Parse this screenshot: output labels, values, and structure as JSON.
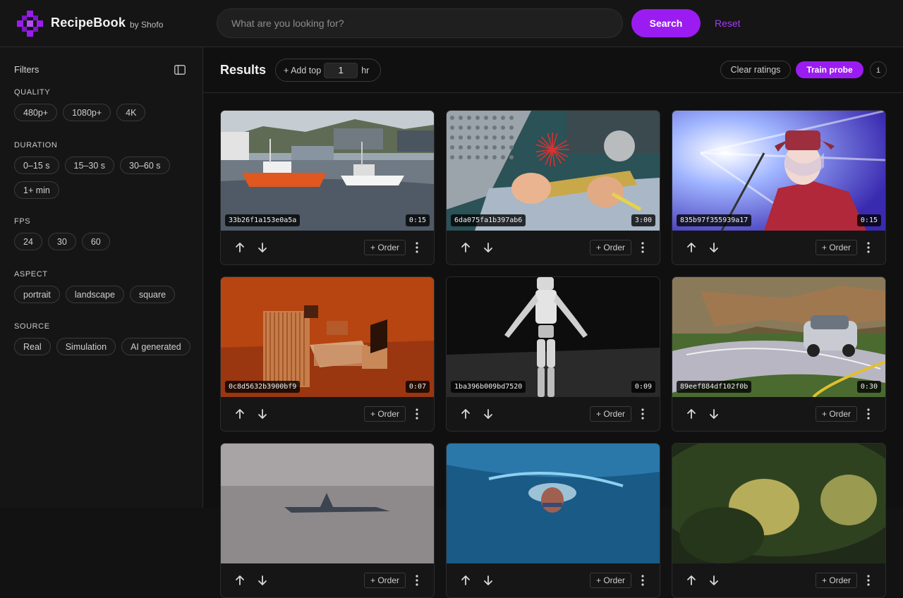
{
  "header": {
    "brand": "RecipeBook",
    "brand_sub": "by Shofo",
    "search_placeholder": "What are you looking for?",
    "search_value": "",
    "search_label": "Search",
    "reset_label": "Reset",
    "accent_color": "#9b1cf0"
  },
  "sidebar": {
    "title": "Filters",
    "groups": [
      {
        "label": "QUALITY",
        "options": [
          "480p+",
          "1080p+",
          "4K"
        ]
      },
      {
        "label": "DURATION",
        "options": [
          "0–15 s",
          "15–30 s",
          "30–60 s",
          "1+ min"
        ]
      },
      {
        "label": "FPS",
        "options": [
          "24",
          "30",
          "60"
        ]
      },
      {
        "label": "ASPECT",
        "options": [
          "portrait",
          "landscape",
          "square"
        ]
      },
      {
        "label": "SOURCE",
        "options": [
          "Real",
          "Simulation",
          "AI generated"
        ]
      }
    ]
  },
  "results": {
    "title": "Results",
    "add_top_prefix": "+ Add top",
    "add_top_value": "1",
    "add_top_unit": "hr",
    "clear_label": "Clear ratings",
    "train_label": "Train probe",
    "info_label": "i"
  },
  "cards": [
    {
      "id": "33b26f1a153e0a5a",
      "duration": "0:15",
      "order_label": "+ Order",
      "scene": "harbor"
    },
    {
      "id": "6da075fa1b397ab6",
      "duration": "3:00",
      "order_label": "+ Order",
      "scene": "crafting"
    },
    {
      "id": "835b97f355939a17",
      "duration": "0:15",
      "order_label": "+ Order",
      "scene": "anime"
    },
    {
      "id": "0c8d5632b3900bf9",
      "duration": "0:07",
      "order_label": "+ Order",
      "scene": "bedroom"
    },
    {
      "id": "1ba396b009bd7520",
      "duration": "0:09",
      "order_label": "+ Order",
      "scene": "robot"
    },
    {
      "id": "89eef884df102f0b",
      "duration": "0:30",
      "order_label": "+ Order",
      "scene": "car"
    },
    {
      "id": "",
      "duration": "",
      "order_label": "+ Order",
      "scene": "airplane"
    },
    {
      "id": "",
      "duration": "",
      "order_label": "+ Order",
      "scene": "swimmer"
    },
    {
      "id": "",
      "duration": "",
      "order_label": "+ Order",
      "scene": "food"
    }
  ]
}
